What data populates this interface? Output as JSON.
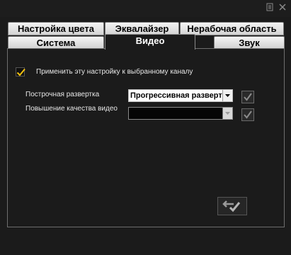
{
  "titlebar": {
    "menu_icon": "menu-icon",
    "close_icon": "close-icon"
  },
  "tabs": {
    "row1": [
      "Настройка цвета",
      "Эквалайзер",
      "Нерабочая область"
    ],
    "row2": [
      "Система",
      "Видео",
      "Звук"
    ],
    "active": "Видео"
  },
  "video": {
    "apply_to_channel_label": "Применить эту настройку к выбранному каналу",
    "apply_to_channel_checked": true,
    "scan_label": "Построчная развертка",
    "scan_value": "Прогрессивная разверт",
    "enhance_label": "Повышение качества видео",
    "enhance_value": "",
    "apply_button_icon": "apply-arrow-check-icon"
  },
  "colors": {
    "accent_check": "#f2c20f",
    "background": "#1b1b1b"
  }
}
